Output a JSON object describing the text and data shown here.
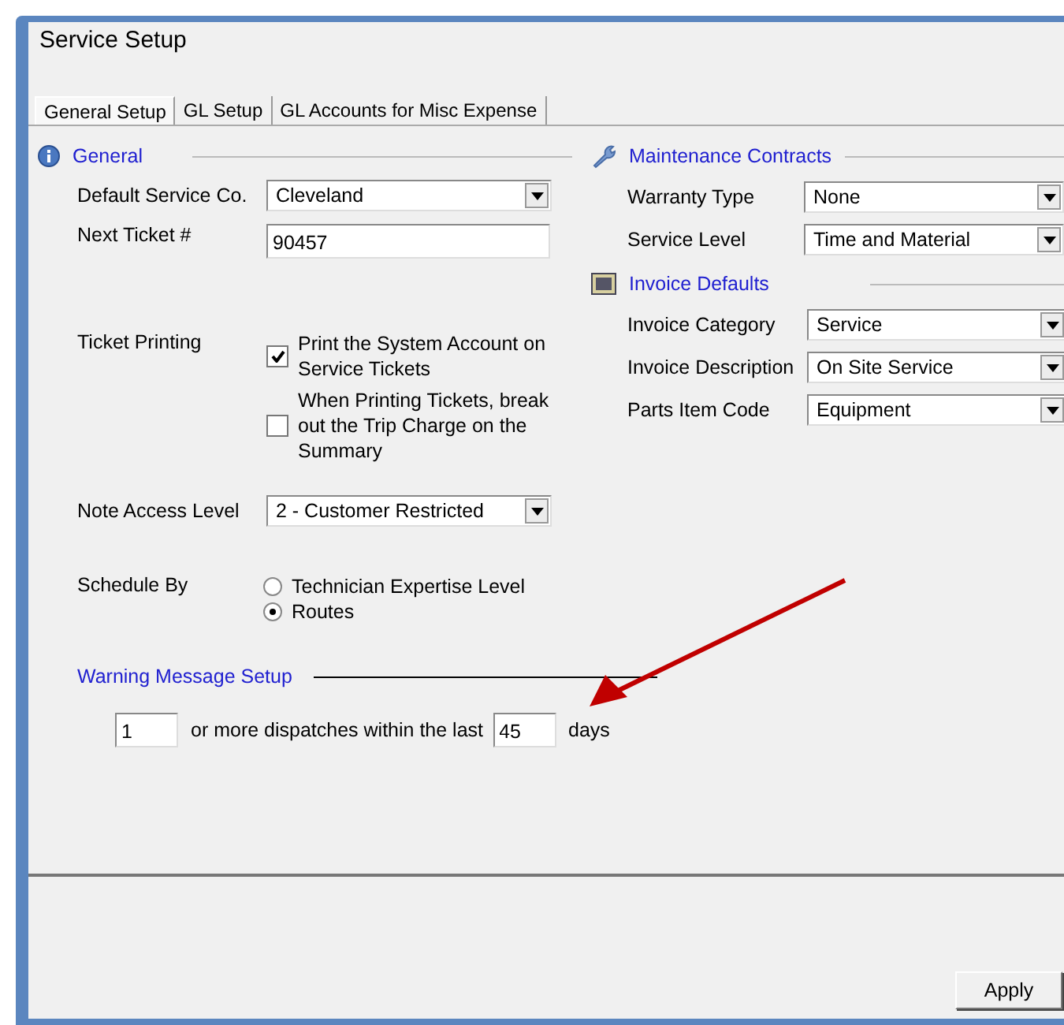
{
  "window": {
    "title": "Service Setup"
  },
  "tabs": [
    {
      "label": "General Setup",
      "selected": true
    },
    {
      "label": "GL Setup",
      "selected": false
    },
    {
      "label": "GL Accounts for Misc Expense",
      "selected": false
    }
  ],
  "general": {
    "heading": "General",
    "default_service_co": {
      "label": "Default Service Co.",
      "value": "Cleveland"
    },
    "next_ticket": {
      "label": "Next Ticket #",
      "value": "90457"
    },
    "ticket_printing": {
      "label": "Ticket Printing",
      "options": [
        {
          "label": "Print the System Account on Service Tickets",
          "checked": true
        },
        {
          "label": "When Printing Tickets, break out the Trip Charge on the Summary",
          "checked": false
        }
      ]
    },
    "note_access_level": {
      "label": "Note Access Level",
      "value": "2 - Customer Restricted"
    },
    "schedule_by": {
      "label": "Schedule By",
      "options": [
        {
          "label": "Technician Expertise Level",
          "selected": false
        },
        {
          "label": "Routes",
          "selected": true
        }
      ]
    }
  },
  "maintenance_contracts": {
    "heading": "Maintenance Contracts",
    "fields": [
      {
        "label": "Warranty Type",
        "value": "None"
      },
      {
        "label": "Service Level",
        "value": "Time and Material"
      }
    ]
  },
  "invoice_defaults": {
    "heading": "Invoice Defaults",
    "fields": [
      {
        "label": "Invoice Category",
        "value": "Service"
      },
      {
        "label": "Invoice Description",
        "value": "On Site Service"
      },
      {
        "label": "Parts Item Code",
        "value": "Equipment"
      }
    ]
  },
  "warning_message": {
    "heading": "Warning Message Setup",
    "count": "1",
    "middle_text": "or more dispatches within the last",
    "days_value": "45",
    "days_label": "days"
  },
  "buttons": [
    {
      "label": "Apply"
    }
  ]
}
